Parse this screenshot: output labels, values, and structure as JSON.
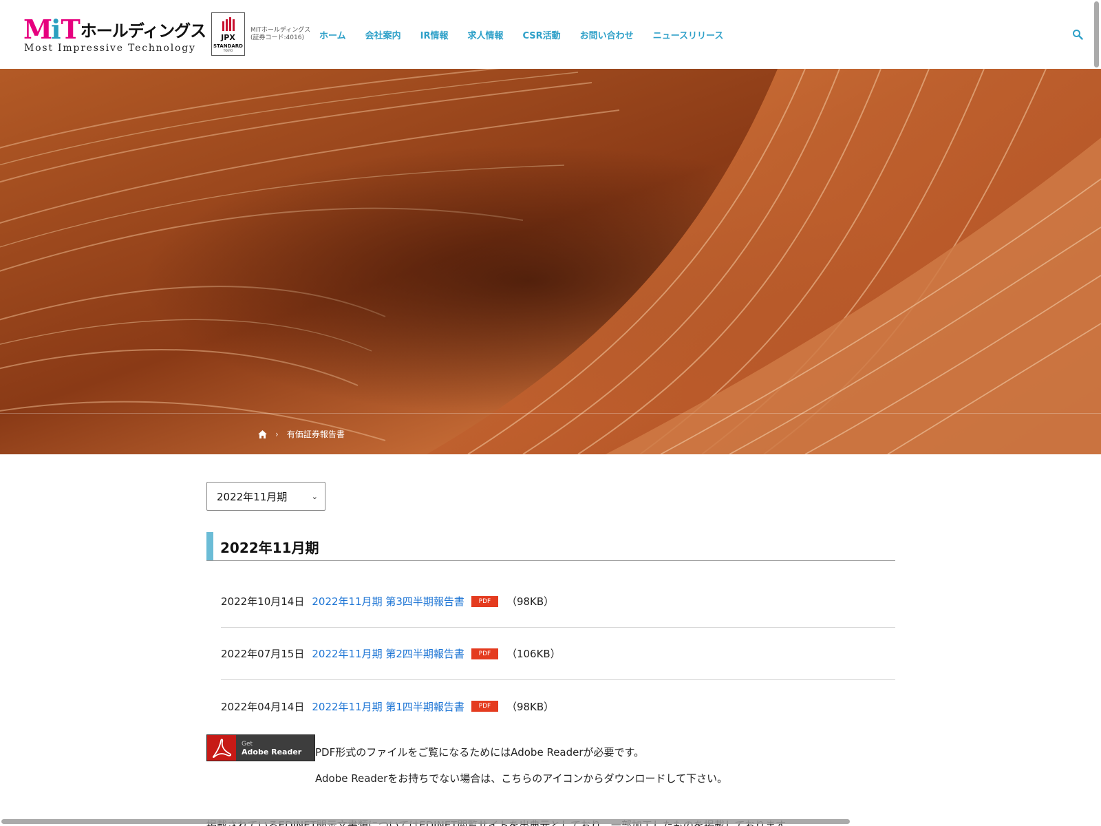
{
  "header": {
    "logo_letters": {
      "m": "M",
      "i": "i",
      "t": "T"
    },
    "logo_kana": "ホールディングス",
    "logo_tagline": "Most Impressive Technology",
    "jpx_badge": {
      "name": "JPX",
      "standard": "STANDARD",
      "city": "TOKYO"
    },
    "company_note_line1": "MITホールディングス",
    "company_note_line2": "(証券コード:4016)",
    "nav": [
      "ホーム",
      "会社案内",
      "IR情報",
      "求人情報",
      "CSR活動",
      "お問い合わせ",
      "ニュースリリース"
    ],
    "search_icon": "search-icon",
    "accent_color": "#2ea0c8",
    "brand_color": "#e6007e"
  },
  "hero": {
    "image": "red sandstone wave rock formation",
    "breadcrumb": {
      "home_icon": "home-icon",
      "separator": "›",
      "current": "有価証券報告書"
    }
  },
  "main": {
    "period_select": {
      "selected": "2022年11月期"
    },
    "section_title": "2022年11月期",
    "reports": [
      {
        "date": "2022年10月14日",
        "title": "2022年11月期 第3四半期報告書",
        "badge": "PDF",
        "size": "（98KB）"
      },
      {
        "date": "2022年07月15日",
        "title": "2022年11月期 第2四半期報告書",
        "badge": "PDF",
        "size": "（106KB）"
      },
      {
        "date": "2022年04月14日",
        "title": "2022年11月期 第1四半期報告書",
        "badge": "PDF",
        "size": "（98KB）"
      }
    ],
    "adobe_button": {
      "get": "Get",
      "name": "Adobe Reader"
    },
    "adobe_note_line1": "PDF形式のファイルをご覧になるためにはAdobe Readerが必要です。",
    "adobe_note_line2": "Adobe Readerをお持ちでない場合は、こちらのアイコンからダウンロードして下さい。",
    "edinet_note": "掲載されているEDINET開示文書類についてはEDINET閲覧サイトを出典元としており、一部加工したものを掲載しております。"
  }
}
